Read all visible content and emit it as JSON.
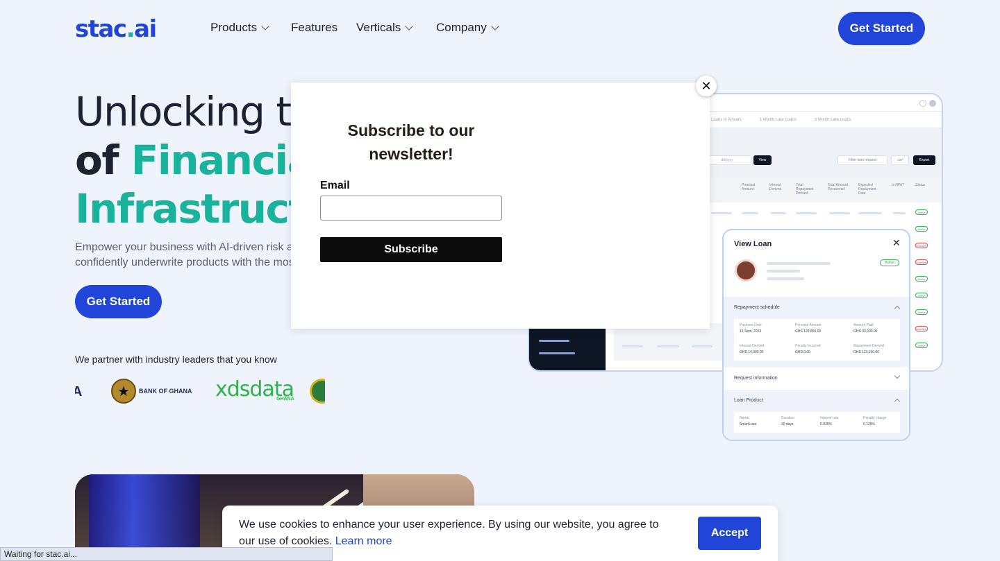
{
  "nav": {
    "logo_text": "stac",
    "logo_dot": ".",
    "logo_suffix": "ai",
    "items": [
      {
        "label": "Products"
      },
      {
        "label": "Features"
      },
      {
        "label": "Verticals"
      },
      {
        "label": "Company"
      }
    ],
    "cta_label": "Get Started"
  },
  "hero": {
    "title_line1": "Unlocking the",
    "title_line2_prefix": "of ",
    "title_line2_teal": "Financial Tr",
    "title_line3": "Infrastructure",
    "subtitle_line1": "Empower your business with AI-driven risk ass",
    "subtitle_line2": "confidently underwrite products with the mos",
    "cta_label": "Get Started",
    "partners_label": "We partner with industry leaders that you know",
    "partners": [
      {
        "name": "BANK OF GHANA"
      },
      {
        "name": "xdsdata",
        "sub": "GHANA"
      }
    ]
  },
  "dashboard": {
    "tabs": [
      "Loans in Arrears",
      "1 Month Late Loans",
      "3 Month Late Loans"
    ],
    "date_placeholder": "dd/yyyy",
    "view_label": "View",
    "filter_label": "Filter loan request",
    "csv_label": "csv",
    "export_label": "Export",
    "columns": [
      "Principal Amount",
      "Interest Derived",
      "Total Repayment Derived",
      "Total Amount Recovered",
      "Expected Repayment Date",
      "Is NPA?",
      "Status"
    ],
    "statuses": [
      "Active",
      "Active",
      "Inactive",
      "Inactive",
      "Active",
      "Active",
      "Active",
      "Inactive",
      "Active"
    ]
  },
  "loan_card": {
    "title": "View Loan",
    "status": "Active",
    "sections": {
      "repayment": "Repayment schedule",
      "request": "Request information",
      "product": "Loan Product"
    },
    "repayment_fields": [
      {
        "k": "Payment Date",
        "v": "13 Sept, 2023"
      },
      {
        "k": "Principal Amount",
        "v": "GHS 129,850.00"
      },
      {
        "k": "Amount Paid",
        "v": "GHS 33,600.00"
      },
      {
        "k": "Interest Derived",
        "v": "GHS 14,000.00"
      },
      {
        "k": "Penalty Incurred",
        "v": "GHS 0.00"
      },
      {
        "k": "Repayment Derived",
        "v": "GHS 113,150.00"
      }
    ],
    "product_fields": [
      {
        "k": "Name",
        "v": "SmartLoan"
      },
      {
        "k": "Duration",
        "v": "30 days"
      },
      {
        "k": "Interest rate",
        "v": "0.035%"
      },
      {
        "k": "Penalty charge",
        "v": "0.125%"
      }
    ]
  },
  "modal": {
    "title": "Subscribe to our newsletter!",
    "email_label": "Email",
    "email_value": "",
    "submit_label": "Subscribe",
    "close_symbol": "✕"
  },
  "cookie": {
    "text": "We use cookies to enhance your user experience. By using our website, you agree to our use of cookies. ",
    "link_label": "Learn more",
    "accept_label": "Accept"
  },
  "statusbar": {
    "text": "Waiting for stac.ai..."
  }
}
